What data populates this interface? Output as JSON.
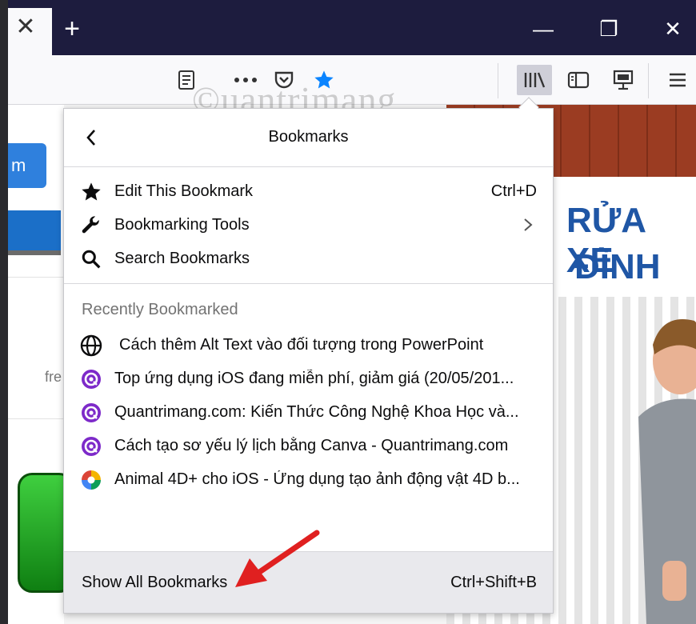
{
  "tabbar": {
    "tab_close_glyph": "✕",
    "new_tab_glyph": "+",
    "minimize_glyph": "—",
    "restore_glyph": "❐",
    "close_glyph": "✕"
  },
  "watermark": {
    "text": "©uantrimang"
  },
  "page_content": {
    "blue_button_text": "m",
    "fre_text": "fre"
  },
  "ad": {
    "line1": "RỬA XE",
    "line2": "ĐÌNH"
  },
  "panel": {
    "title": "Bookmarks",
    "back_icon": "chevron-left-icon",
    "menu_items": [
      {
        "label": "Edit This Bookmark",
        "shortcut": "Ctrl+D",
        "icon": "star-icon"
      },
      {
        "label": "Bookmarking Tools",
        "shortcut": "",
        "icon": "wrench-icon",
        "has_submenu": true
      },
      {
        "label": "Search Bookmarks",
        "shortcut": "",
        "icon": "search-icon"
      }
    ],
    "recent_heading": "Recently Bookmarked",
    "recent_items": [
      {
        "label": "Cách thêm Alt Text vào đối tượng trong PowerPoint",
        "icon": "globe-icon"
      },
      {
        "label": "Top ứng dụng iOS đang miễn phí, giảm giá (20/05/201...",
        "icon": "quantrimang-icon"
      },
      {
        "label": "Quantrimang.com: Kiến Thức Công Nghệ Khoa Học và...",
        "icon": "quantrimang-icon"
      },
      {
        "label": "Cách tạo sơ yếu lý lịch bằng Canva - Quantrimang.com",
        "icon": "quantrimang-icon"
      },
      {
        "label": "Animal 4D+ cho iOS - Ứng dụng tạo ảnh động vật 4D b...",
        "icon": "multicolor-app-icon"
      }
    ],
    "footer": {
      "label": "Show All Bookmarks",
      "shortcut": "Ctrl+Shift+B"
    }
  },
  "colors": {
    "tabbar_bg": "#1d1c3e",
    "toolbar_bg": "#f9f9fb",
    "accent_blue": "#0060df",
    "quantrimang_purple": "#7d2ac9",
    "arrow_red": "#e02020"
  }
}
